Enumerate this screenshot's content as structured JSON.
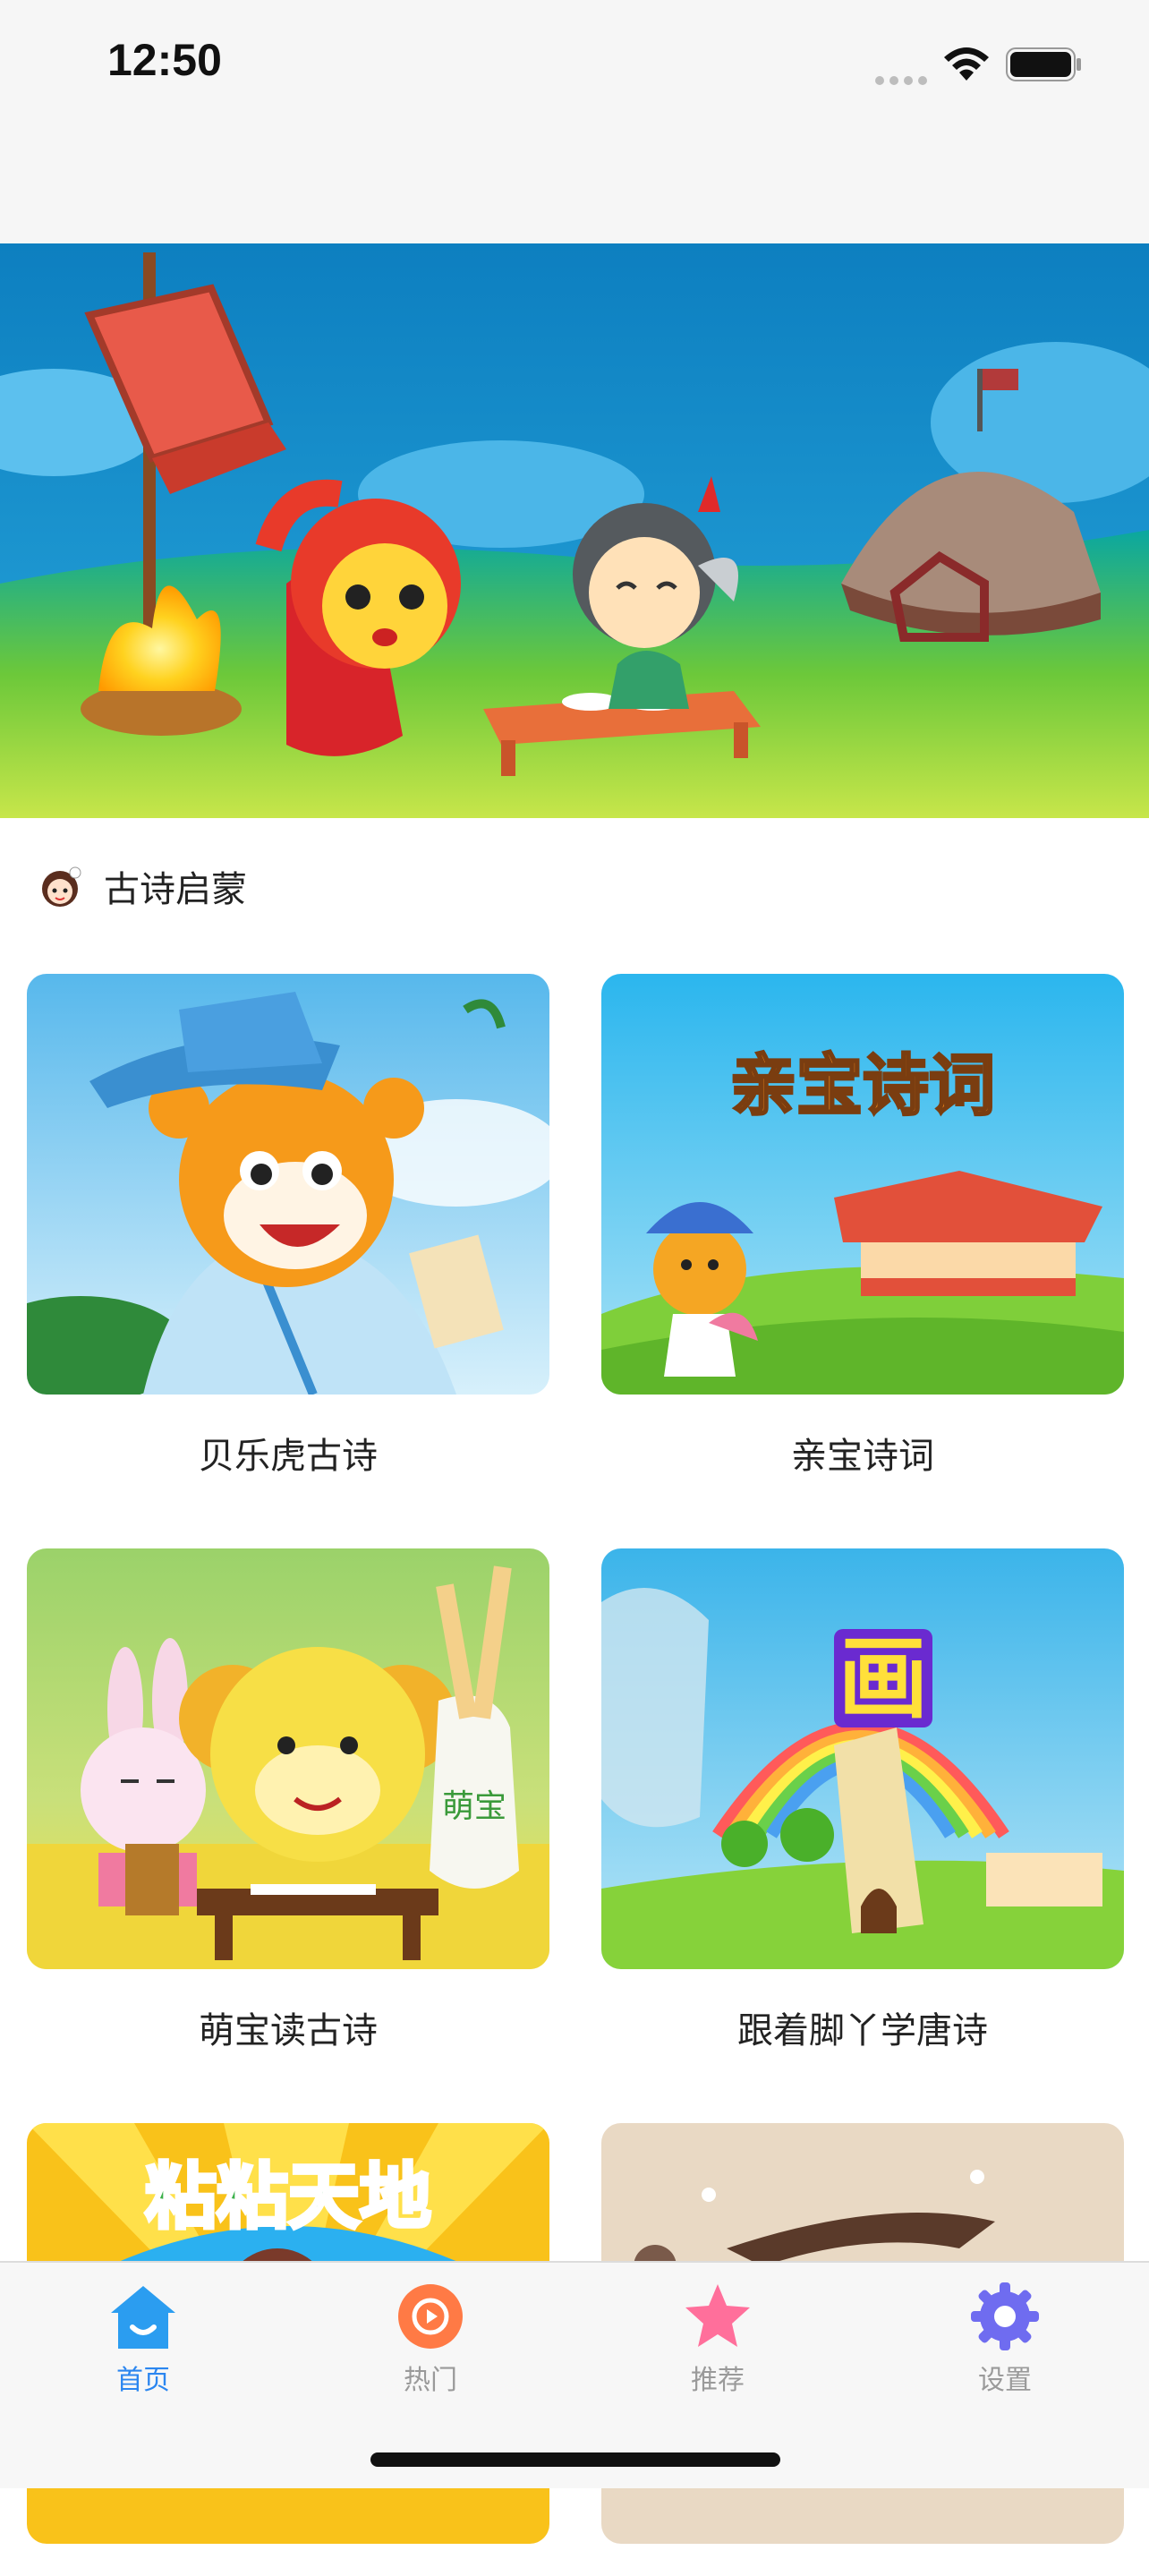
{
  "status_bar": {
    "time": "12:50"
  },
  "section": {
    "title": "古诗启蒙"
  },
  "cards": [
    {
      "label": "贝乐虎古诗"
    },
    {
      "label": "亲宝诗词",
      "thumb_text": "亲宝诗词"
    },
    {
      "label": "萌宝读古诗"
    },
    {
      "label": "跟着脚丫学唐诗",
      "thumb_text": "画"
    },
    {
      "label": "",
      "thumb_text": "粘粘天地"
    },
    {
      "label": ""
    }
  ],
  "tabbar": {
    "tabs": [
      {
        "label": "首页",
        "icon": "home-icon",
        "active": true
      },
      {
        "label": "热门",
        "icon": "play-icon",
        "active": false
      },
      {
        "label": "推荐",
        "icon": "star-icon",
        "active": false
      },
      {
        "label": "设置",
        "icon": "gear-icon",
        "active": false
      }
    ]
  },
  "colors": {
    "accent": "#2b86f0",
    "hot": "#ff7a45",
    "star": "#ff6f9b",
    "gear": "#6f6cf0"
  }
}
